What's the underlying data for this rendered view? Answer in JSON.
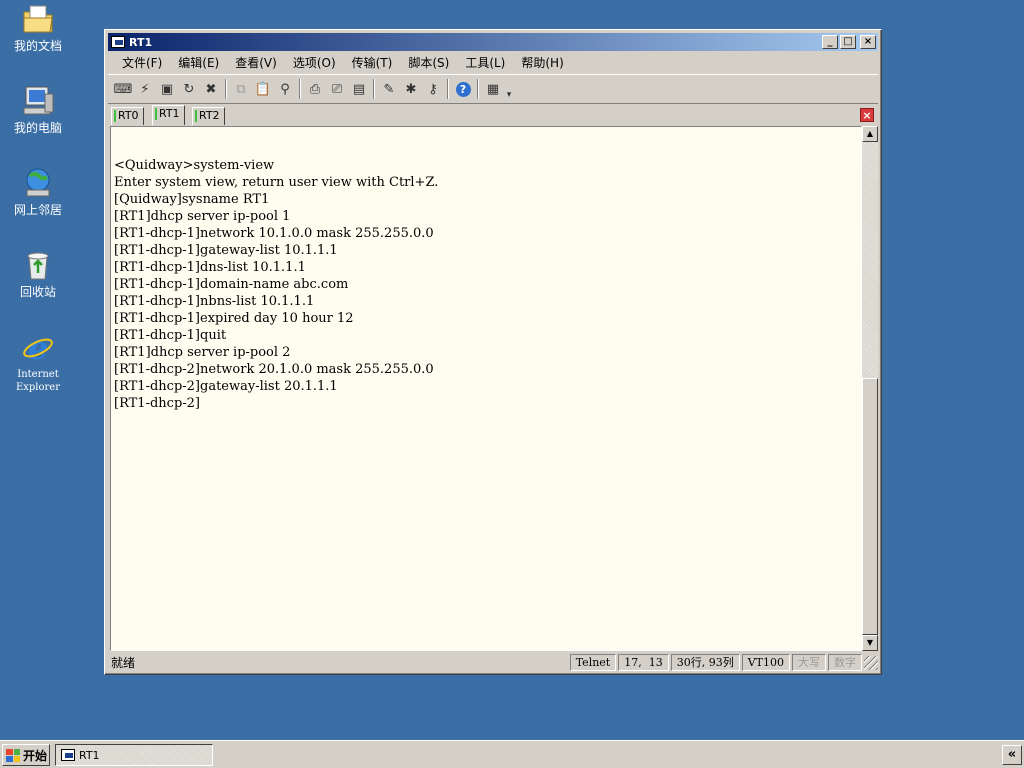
{
  "desktop": {
    "icons": [
      {
        "label": "我的文档",
        "icon": "folder-documents-icon"
      },
      {
        "label": "我的电脑",
        "icon": "computer-icon"
      },
      {
        "label": "网上邻居",
        "icon": "network-icon"
      },
      {
        "label": "回收站",
        "icon": "recycle-bin-icon"
      },
      {
        "label": "Internet\nExplorer",
        "icon": "internet-explorer-icon"
      }
    ]
  },
  "window": {
    "title": "RT1",
    "controls": {
      "minimize": "_",
      "maximize": "□",
      "close": "×"
    },
    "menu": [
      "文件(F)",
      "编辑(E)",
      "查看(V)",
      "选项(O)",
      "传输(T)",
      "脚本(S)",
      "工具(L)",
      "帮助(H)"
    ],
    "tabs": [
      "RT0",
      "RT1",
      "RT2"
    ],
    "active_tab": "RT1",
    "terminal_lines": [
      "<Quidway>system-view",
      "Enter system view, return user view with Ctrl+Z.",
      "[Quidway]sysname RT1",
      "[RT1]dhcp server ip-pool 1",
      "[RT1-dhcp-1]network 10.1.0.0 mask 255.255.0.0",
      "[RT1-dhcp-1]gateway-list 10.1.1.1",
      "[RT1-dhcp-1]dns-list 10.1.1.1",
      "[RT1-dhcp-1]domain-name abc.com",
      "[RT1-dhcp-1]nbns-list 10.1.1.1",
      "[RT1-dhcp-1]expired day 10 hour 12",
      "[RT1-dhcp-1]quit",
      "[RT1]dhcp server ip-pool 2",
      "[RT1-dhcp-2]network 20.1.0.0 mask 255.255.0.0",
      "[RT1-dhcp-2]gateway-list 20.1.1.1",
      "[RT1-dhcp-2]"
    ],
    "status": {
      "text": "就绪",
      "protocol": "Telnet",
      "cursor": "17,  13",
      "size": "30行, 93列",
      "emulation": "VT100",
      "caps": "大写",
      "num": "数字"
    }
  },
  "taskbar": {
    "start_label": "开始",
    "task_label": "RT1",
    "tray_label": "«"
  },
  "colors": {
    "desktop": "#3a6ea5",
    "titlebar_start": "#0a246a",
    "titlebar_end": "#a6caf0",
    "terminal_bg": "#fffcf0"
  }
}
